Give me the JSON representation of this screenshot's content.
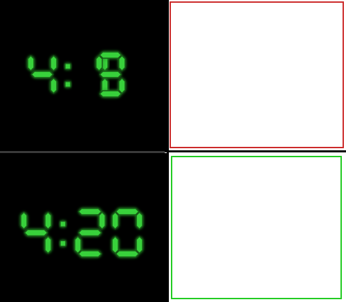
{
  "clocks": [
    {
      "time": "4:19",
      "digits": [
        "4",
        ":",
        "1",
        "9"
      ]
    },
    {
      "time": "4:20",
      "digits": [
        "4",
        ":",
        "2",
        "0"
      ]
    }
  ],
  "colors": {
    "background": "#000000",
    "digit_fill": "#39d13a",
    "digit_glow": "#145c14",
    "top_box_border": "#cc2a2a",
    "bottom_box_border": "#22cc22"
  }
}
